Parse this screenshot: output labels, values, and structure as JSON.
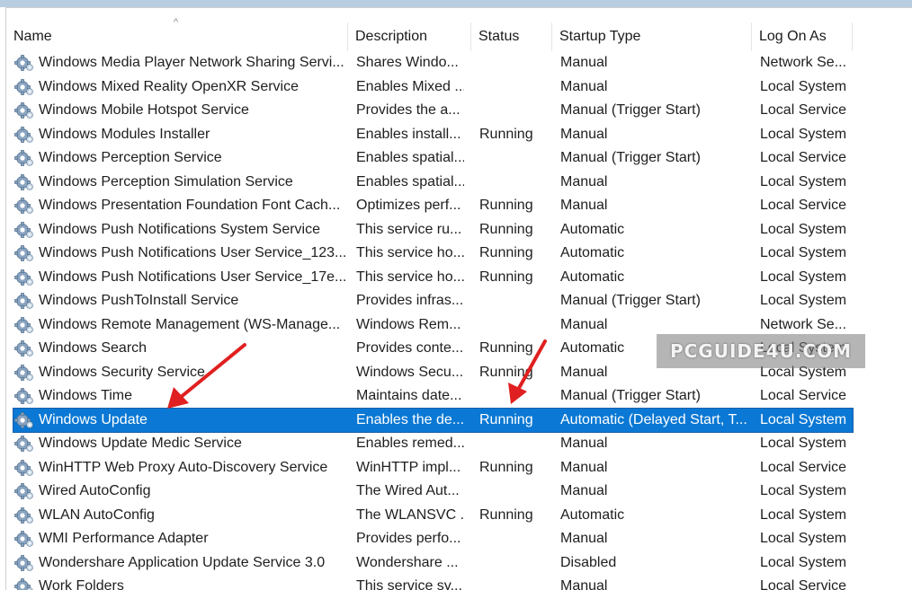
{
  "columns": {
    "name": "Name",
    "description": "Description",
    "status": "Status",
    "startup_type": "Startup Type",
    "log_on_as": "Log On As"
  },
  "colors": {
    "selection": "#0a78d4",
    "arrow": "#e02020",
    "header_strip": "#b9cde0"
  },
  "icon": "gear-icon",
  "sort_indicator": "^",
  "watermark": "PCGUIDE4U.COM",
  "services": [
    {
      "name": "Windows Media Player Network Sharing Servi...",
      "description": "Shares Windo...",
      "status": "",
      "startup": "Manual",
      "logon": "Network Se..."
    },
    {
      "name": "Windows Mixed Reality OpenXR Service",
      "description": "Enables Mixed ...",
      "status": "",
      "startup": "Manual",
      "logon": "Local System"
    },
    {
      "name": "Windows Mobile Hotspot Service",
      "description": "Provides the a...",
      "status": "",
      "startup": "Manual (Trigger Start)",
      "logon": "Local Service"
    },
    {
      "name": "Windows Modules Installer",
      "description": "Enables install...",
      "status": "Running",
      "startup": "Manual",
      "logon": "Local System"
    },
    {
      "name": "Windows Perception Service",
      "description": "Enables spatial...",
      "status": "",
      "startup": "Manual (Trigger Start)",
      "logon": "Local Service"
    },
    {
      "name": "Windows Perception Simulation Service",
      "description": "Enables spatial...",
      "status": "",
      "startup": "Manual",
      "logon": "Local System"
    },
    {
      "name": "Windows Presentation Foundation Font Cach...",
      "description": "Optimizes perf...",
      "status": "Running",
      "startup": "Manual",
      "logon": "Local Service"
    },
    {
      "name": "Windows Push Notifications System Service",
      "description": "This service ru...",
      "status": "Running",
      "startup": "Automatic",
      "logon": "Local System"
    },
    {
      "name": "Windows Push Notifications User Service_123...",
      "description": "This service ho...",
      "status": "Running",
      "startup": "Automatic",
      "logon": "Local System"
    },
    {
      "name": "Windows Push Notifications User Service_17e...",
      "description": "This service ho...",
      "status": "Running",
      "startup": "Automatic",
      "logon": "Local System"
    },
    {
      "name": "Windows PushToInstall Service",
      "description": "Provides infras...",
      "status": "",
      "startup": "Manual (Trigger Start)",
      "logon": "Local System"
    },
    {
      "name": "Windows Remote Management (WS-Manage...",
      "description": "Windows Rem...",
      "status": "",
      "startup": "Manual",
      "logon": "Network Se..."
    },
    {
      "name": "Windows Search",
      "description": "Provides conte...",
      "status": "Running",
      "startup": "Automatic",
      "logon": "Local System"
    },
    {
      "name": "Windows Security Service",
      "description": "Windows Secu...",
      "status": "Running",
      "startup": "Manual",
      "logon": "Local System"
    },
    {
      "name": "Windows Time",
      "description": "Maintains date...",
      "status": "",
      "startup": "Manual (Trigger Start)",
      "logon": "Local Service"
    },
    {
      "name": "Windows Update",
      "description": "Enables the de...",
      "status": "Running",
      "startup": "Automatic (Delayed Start, T...",
      "logon": "Local System",
      "selected": true
    },
    {
      "name": "Windows Update Medic Service",
      "description": "Enables remed...",
      "status": "",
      "startup": "Manual",
      "logon": "Local System"
    },
    {
      "name": "WinHTTP Web Proxy Auto-Discovery Service",
      "description": "WinHTTP impl...",
      "status": "Running",
      "startup": "Manual",
      "logon": "Local Service"
    },
    {
      "name": "Wired AutoConfig",
      "description": "The Wired Aut...",
      "status": "",
      "startup": "Manual",
      "logon": "Local System"
    },
    {
      "name": "WLAN AutoConfig",
      "description": "The WLANSVC ...",
      "status": "Running",
      "startup": "Automatic",
      "logon": "Local System"
    },
    {
      "name": "WMI Performance Adapter",
      "description": "Provides perfo...",
      "status": "",
      "startup": "Manual",
      "logon": "Local System"
    },
    {
      "name": "Wondershare Application Update Service 3.0",
      "description": "Wondershare ...",
      "status": "",
      "startup": "Disabled",
      "logon": "Local System"
    },
    {
      "name": "Work Folders",
      "description": "This service sy...",
      "status": "",
      "startup": "Manual",
      "logon": "Local Service"
    }
  ]
}
